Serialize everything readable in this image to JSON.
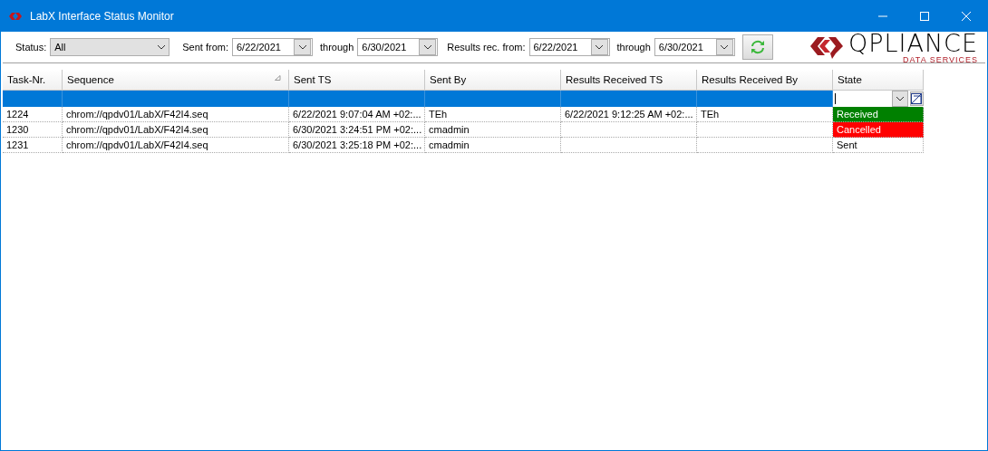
{
  "window": {
    "title": "LabX Interface Status Monitor"
  },
  "filters": {
    "status": {
      "label": "Status:",
      "value": "All"
    },
    "sent_from": {
      "label": "Sent from:",
      "value": "6/22/2021"
    },
    "sent_through": {
      "label": "through",
      "value": "6/30/2021"
    },
    "results_from": {
      "label": "Results rec. from:",
      "value": "6/22/2021"
    },
    "results_through": {
      "label": "through",
      "value": "6/30/2021"
    }
  },
  "logo": {
    "name": "QPLIANCE",
    "tagline": "DATA SERVICES"
  },
  "table": {
    "columns": [
      {
        "label": "Task-Nr.",
        "sorted": false
      },
      {
        "label": "Sequence",
        "sorted": true
      },
      {
        "label": "Sent TS",
        "sorted": false
      },
      {
        "label": "Sent By",
        "sorted": false
      },
      {
        "label": "Results Received TS",
        "sorted": false
      },
      {
        "label": "Results Received By",
        "sorted": false
      },
      {
        "label": "State",
        "sorted": false
      }
    ],
    "filter_row": {
      "selected": true
    },
    "rows": [
      {
        "cells": [
          "1224",
          "chrom://qpdv01/LabX/F42I4.seq",
          "6/22/2021  9:07:04  AM  +02:...",
          "TEh",
          "6/22/2021  9:12:25  AM  +02:...",
          "TEh",
          "Received"
        ],
        "color": "#008000",
        "selected": false
      },
      {
        "cells": [
          "1230",
          "chrom://qpdv01/LabX/F42I4.seq",
          "6/30/2021  3:24:51  PM  +02:...",
          "cmadmin",
          "",
          "",
          "Cancelled"
        ],
        "color": "#ff0000",
        "selected": false
      },
      {
        "cells": [
          "1231",
          "chrom://qpdv01/LabX/F42I4.seq",
          "6/30/2021  3:25:18  PM  +02:...",
          "cmadmin",
          "",
          "",
          "Sent"
        ],
        "selected": false
      }
    ]
  }
}
